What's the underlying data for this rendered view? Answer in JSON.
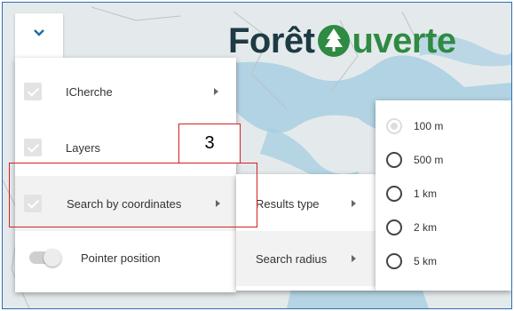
{
  "logo": {
    "text_part1": "Forêt",
    "text_part2": "uverte",
    "color1": "#1e3a44",
    "color2": "#2f8a43"
  },
  "collapse_button": {
    "icon": "chevron-down-icon"
  },
  "menu": {
    "items": [
      {
        "label": "ICherche",
        "checked": true,
        "has_submenu": true
      },
      {
        "label": "Layers",
        "checked": true,
        "has_submenu": true
      },
      {
        "label": "Search by coordinates",
        "checked": true,
        "has_submenu": true
      }
    ],
    "toggle": {
      "label": "Pointer position",
      "on": false
    }
  },
  "submenu": {
    "items": [
      {
        "label": "Results type"
      },
      {
        "label": "Search radius"
      }
    ]
  },
  "radius_options": {
    "items": [
      {
        "label": "100 m",
        "selected": true
      },
      {
        "label": "500 m",
        "selected": false
      },
      {
        "label": "1 km",
        "selected": false
      },
      {
        "label": "2 km",
        "selected": false
      },
      {
        "label": "5 km",
        "selected": false
      }
    ]
  },
  "annotation": {
    "number": "3",
    "color": "#d62020"
  }
}
